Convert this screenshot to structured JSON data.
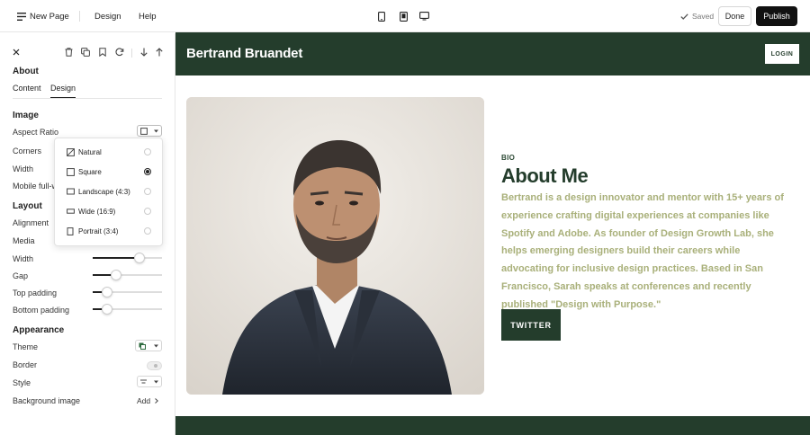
{
  "topbar": {
    "new_page": "New Page",
    "design": "Design",
    "help": "Help",
    "device_icons": [
      "mobile-icon",
      "tablet-icon",
      "desktop-icon"
    ],
    "saved": "Saved",
    "done": "Done",
    "publish": "Publish"
  },
  "panel": {
    "title": "About",
    "tabs": [
      "Content",
      "Design"
    ],
    "active_tab": "Design",
    "toolbar_icons": [
      "trash-icon",
      "duplicate-icon",
      "bookmark-icon",
      "refresh-icon",
      "arrow-down-icon",
      "arrow-up-icon"
    ],
    "image": {
      "heading": "Image",
      "aspect_ratio": "Aspect Ratio",
      "corners": "Corners",
      "width": "Width",
      "mobile_full_width": "Mobile full-width"
    },
    "layout": {
      "heading": "Layout",
      "alignment": "Alignment",
      "media": "Media",
      "width": "Width",
      "gap": "Gap",
      "top_padding": "Top padding",
      "bottom_padding": "Bottom padding",
      "width_value": 0.7,
      "gap_value": 0.3,
      "top_padding_value": 0.15,
      "bottom_padding_value": 0.15
    },
    "appearance": {
      "heading": "Appearance",
      "theme": "Theme",
      "border": "Border",
      "style": "Style",
      "background_image": "Background image",
      "add": "Add"
    }
  },
  "aspect_dropdown": {
    "options": [
      {
        "label": "Natural",
        "icon": "natural-icon",
        "selected": false
      },
      {
        "label": "Square",
        "icon": "square-icon",
        "selected": true
      },
      {
        "label": "Landscape (4:3)",
        "icon": "landscape-icon",
        "selected": false
      },
      {
        "label": "Wide (16:9)",
        "icon": "wide-icon",
        "selected": false
      },
      {
        "label": "Portrait (3:4)",
        "icon": "portrait-icon",
        "selected": false
      }
    ]
  },
  "site": {
    "brand": "Bertrand Bruandet",
    "login": "LOGIN",
    "eyebrow": "BIO",
    "title": "About Me",
    "body": "Bertrand is a design innovator and mentor with 15+ years of experience crafting digital experiences at companies like Spotify and Adobe. As founder of Design Growth Lab, she helps emerging designers build their careers while advocating for inclusive design practices. Based in San Francisco, Sarah speaks at conferences and recently published \"Design with Purpose.\"",
    "cta": "TWITTER",
    "colors": {
      "primary": "#243d2c",
      "text_accent": "#a9b07a"
    }
  }
}
